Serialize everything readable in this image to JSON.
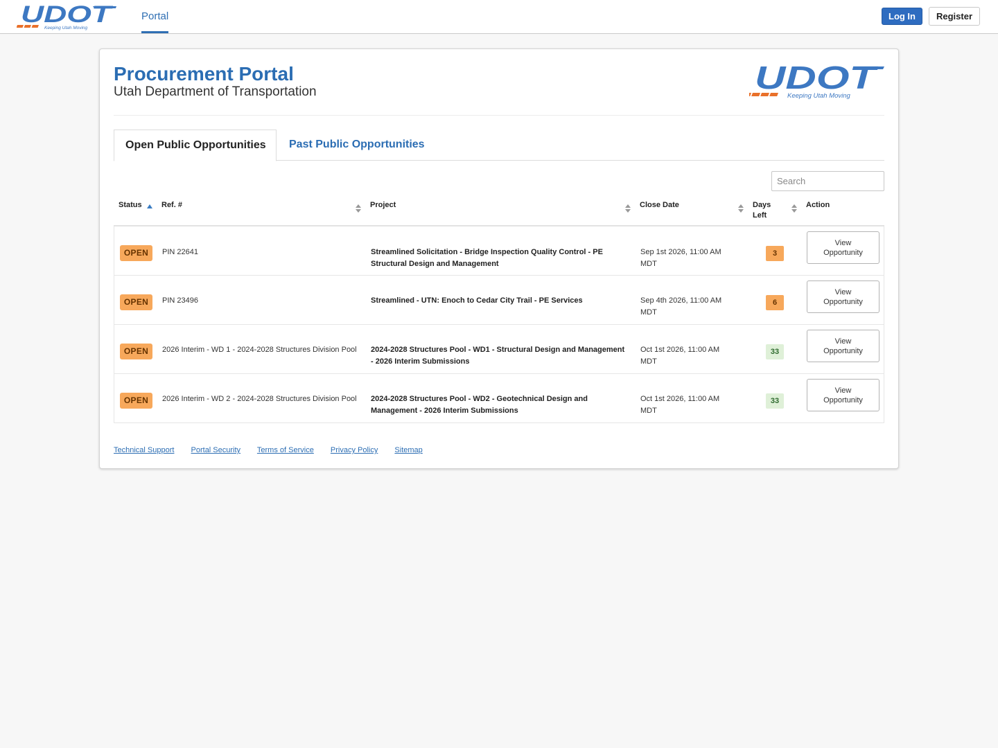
{
  "header": {
    "brand": {
      "name": "UDOT",
      "tagline": "Keeping Utah Moving"
    },
    "nav_tab": "Portal",
    "login_label": "Log In",
    "register_label": "Register"
  },
  "main": {
    "title": "Procurement Portal",
    "subtitle": "Utah Department of Transportation",
    "logo": {
      "name": "UDOT",
      "tagline": "Keeping Utah Moving"
    },
    "tabs": [
      {
        "label": "Open Public Opportunities",
        "active": true
      },
      {
        "label": "Past Public Opportunities",
        "active": false
      }
    ],
    "search": {
      "placeholder": "Search",
      "value": ""
    },
    "table": {
      "columns": {
        "status": "Status",
        "ref": "Ref. #",
        "project": "Project",
        "close_date": "Close Date",
        "days_left_1": "Days",
        "days_left_2": "Left",
        "action": "Action"
      },
      "rows": [
        {
          "status": "OPEN",
          "ref": "PIN 22641",
          "project": "Streamlined Solicitation - Bridge Inspection Quality Control - PE Structural Design and Management",
          "close_date": "Sep 1st 2026, 11:00 AM MDT",
          "days_left": "3",
          "action": "View Opportunity"
        },
        {
          "status": "OPEN",
          "ref": "PIN 23496",
          "project": "Streamlined - UTN: Enoch to Cedar City Trail - PE Services",
          "close_date": "Sep 4th 2026, 11:00 AM MDT",
          "days_left": "6",
          "action": "View Opportunity"
        },
        {
          "status": "OPEN",
          "ref": "2026 Interim - WD 1 - 2024-2028 Structures Division Pool",
          "project": "2024-2028 Structures Pool - WD1 - Structural Design and Management - 2026 Interim Submissions",
          "close_date": "Oct 1st 2026, 11:00 AM MDT",
          "days_left": "33",
          "action": "View Opportunity"
        },
        {
          "status": "OPEN",
          "ref": "2026 Interim - WD 2 - 2024-2028 Structures Division Pool",
          "project": "2024-2028 Structures Pool - WD2 - Geotechnical Design and Management - 2026 Interim Submissions",
          "close_date": "Oct 1st 2026, 11:00 AM MDT",
          "days_left": "33",
          "action": "View Opportunity"
        }
      ]
    },
    "footer_links": [
      "Technical Support",
      "Portal Security",
      "Terms of Service",
      "Privacy Policy",
      "Sitemap"
    ]
  },
  "colors": {
    "brand_blue": "#2b6db3",
    "brand_orange": "#e9702a",
    "status_open": "#f7a85b",
    "days_ok": "#dff0d8"
  }
}
